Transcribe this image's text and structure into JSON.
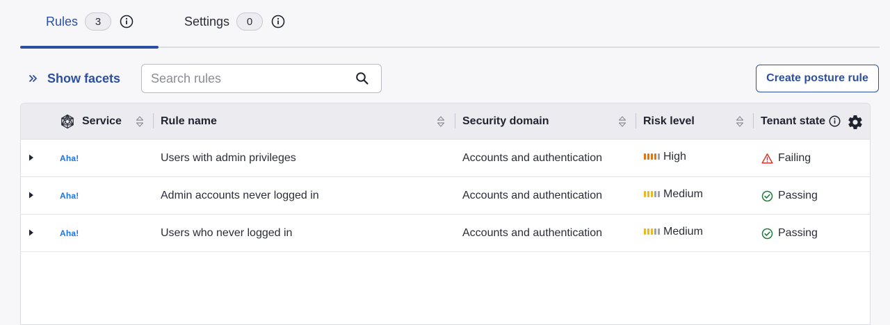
{
  "tabs": [
    {
      "label": "Rules",
      "count": "3"
    },
    {
      "label": "Settings",
      "count": "0"
    }
  ],
  "toolbar": {
    "show_facets": "Show facets",
    "search_placeholder": "Search rules",
    "create_button": "Create posture rule"
  },
  "table": {
    "headers": {
      "service": "Service",
      "rule_name": "Rule name",
      "security_domain": "Security domain",
      "risk_level": "Risk level",
      "tenant_state": "Tenant state"
    },
    "rows": [
      {
        "service": "Aha!",
        "rule_name": "Users with admin privileges",
        "security_domain": "Accounts and authentication",
        "risk_level": "High",
        "tenant_state": "Failing"
      },
      {
        "service": "Aha!",
        "rule_name": "Admin accounts never logged in",
        "security_domain": "Accounts and authentication",
        "risk_level": "Medium",
        "tenant_state": "Passing"
      },
      {
        "service": "Aha!",
        "rule_name": "Users who never logged in",
        "security_domain": "Accounts and authentication",
        "risk_level": "Medium",
        "tenant_state": "Passing"
      }
    ]
  },
  "colors": {
    "accent": "#2d4fa3",
    "risk_high": "#e8730c",
    "risk_medium": "#f0b71c",
    "risk_empty": "#a0a0a8",
    "failing": "#d9342b",
    "passing": "#1e7a3c",
    "service_logo": "#1a73e8"
  },
  "icons": {
    "info": "info-icon",
    "search": "search-icon",
    "chevrons": "double-chevron-right-icon",
    "service_header": "network-icon",
    "sort": "sort-icon",
    "settings": "gear-icon",
    "expand": "caret-right-icon",
    "failing": "warning-triangle-icon",
    "passing": "check-circle-icon"
  }
}
